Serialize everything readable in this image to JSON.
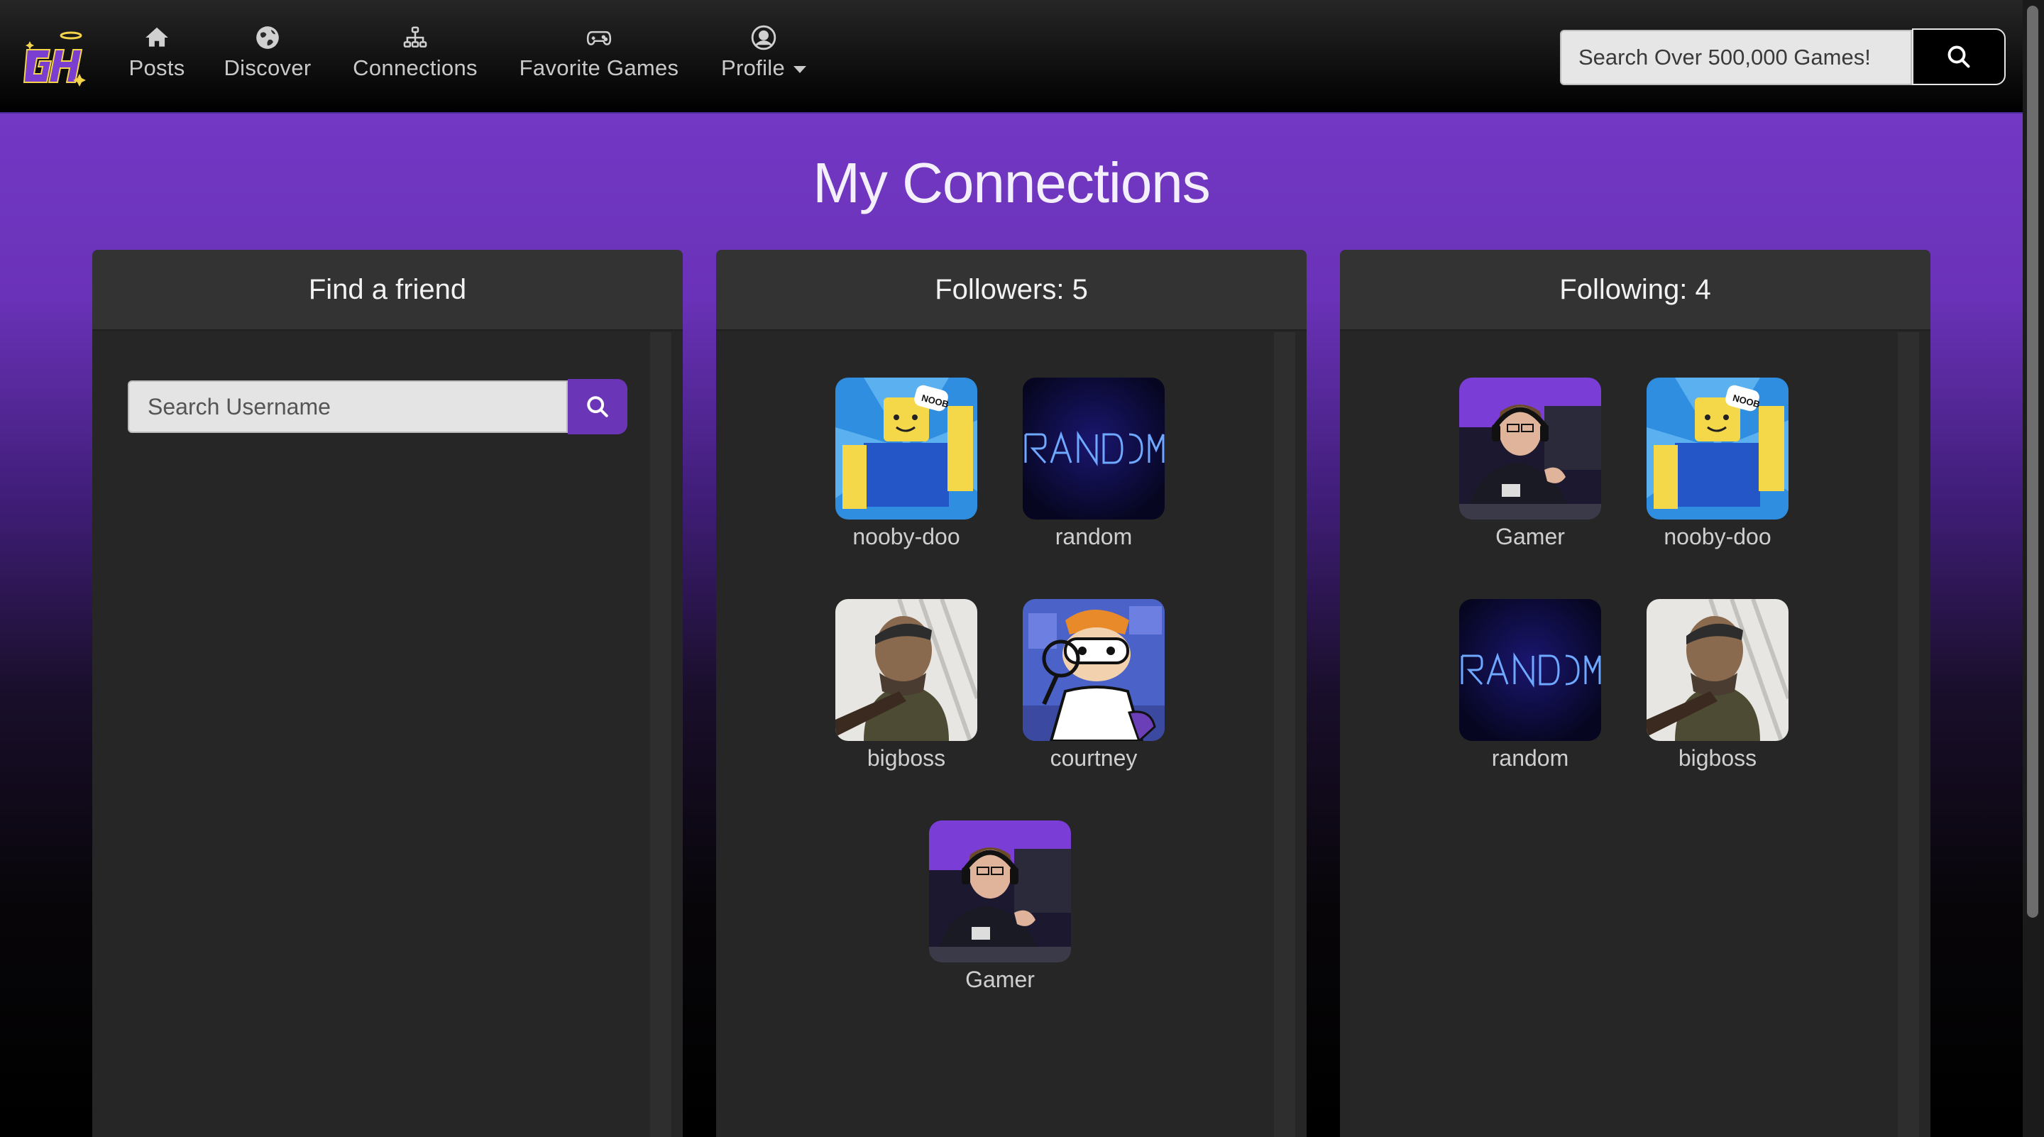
{
  "logo": {
    "text": "GH"
  },
  "nav": {
    "items": [
      {
        "label": "Posts",
        "icon": "home-icon"
      },
      {
        "label": "Discover",
        "icon": "globe-icon"
      },
      {
        "label": "Connections",
        "icon": "network-icon"
      },
      {
        "label": "Favorite Games",
        "icon": "gamepad-icon"
      },
      {
        "label": "Profile",
        "icon": "user-circle-icon"
      }
    ],
    "search_placeholder": "Search Over 500,000 Games!"
  },
  "page": {
    "title": "My Connections"
  },
  "find_friend": {
    "header": "Find a friend",
    "search_placeholder": "Search Username"
  },
  "followers": {
    "header": "Followers: 5",
    "users": [
      {
        "name": "nooby-doo",
        "avatar": "noob-avatar"
      },
      {
        "name": "random",
        "avatar": "random-avatar"
      },
      {
        "name": "bigboss",
        "avatar": "soldier-avatar"
      },
      {
        "name": "courtney",
        "avatar": "cartoon-avatar"
      },
      {
        "name": "Gamer",
        "avatar": "gamer-avatar"
      }
    ]
  },
  "following": {
    "header": "Following: 4",
    "users": [
      {
        "name": "Gamer",
        "avatar": "gamer-avatar"
      },
      {
        "name": "nooby-doo",
        "avatar": "noob-avatar"
      },
      {
        "name": "random",
        "avatar": "random-avatar"
      },
      {
        "name": "bigboss",
        "avatar": "soldier-avatar"
      }
    ]
  },
  "colors": {
    "accent": "#6b35b8",
    "panel": "#262626",
    "panel_header": "#333333"
  }
}
